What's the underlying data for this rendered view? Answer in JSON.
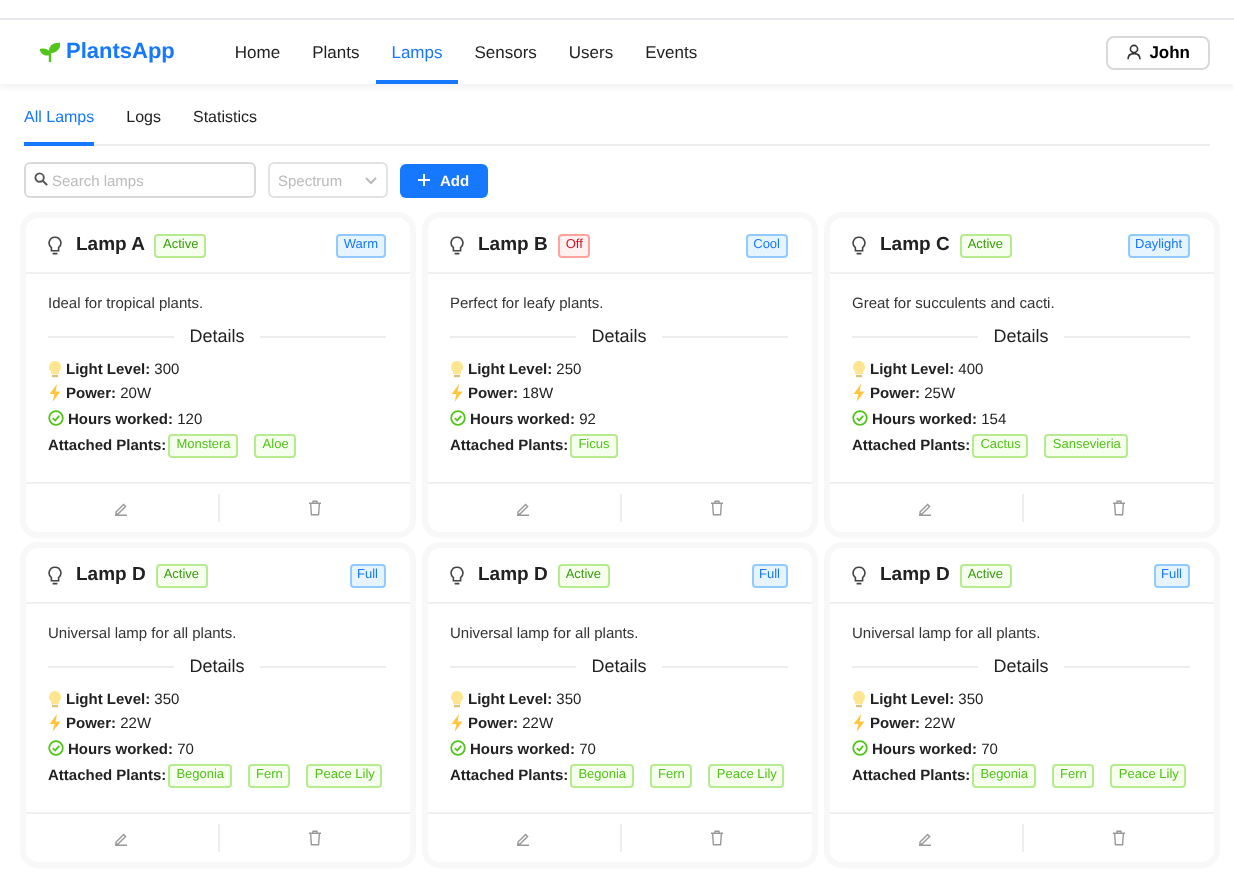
{
  "header": {
    "logo": "PlantsApp",
    "nav": [
      {
        "label": "Home",
        "selected": false
      },
      {
        "label": "Plants",
        "selected": false
      },
      {
        "label": "Lamps",
        "selected": true
      },
      {
        "label": "Sensors",
        "selected": false
      },
      {
        "label": "Users",
        "selected": false
      },
      {
        "label": "Events",
        "selected": false
      }
    ],
    "user": "John"
  },
  "tabs": [
    {
      "label": "All Lamps",
      "selected": true
    },
    {
      "label": "Logs",
      "selected": false
    },
    {
      "label": "Statistics",
      "selected": false
    }
  ],
  "toolbar": {
    "search": {
      "placeholder": "Search lamps"
    },
    "spectrum_select": {
      "placeholder": "Spectrum"
    },
    "add_button": "Add"
  },
  "lamps": [
    {
      "name": "Lamp A",
      "status": {
        "label": "Active",
        "kind": "active"
      },
      "spectrum": "Warm",
      "description": "Ideal for tropical plants.",
      "details_title": "Details",
      "stats": [
        {
          "kind": "light",
          "label": "Light Level:",
          "value": "300"
        },
        {
          "kind": "power",
          "label": "Power:",
          "value": "20W"
        },
        {
          "kind": "hours",
          "label": "Hours worked:",
          "value": "120"
        }
      ],
      "plants_label": "Attached Plants:",
      "plants": [
        "Monstera",
        "Aloe"
      ]
    },
    {
      "name": "Lamp B",
      "status": {
        "label": "Off",
        "kind": "off"
      },
      "spectrum": "Cool",
      "description": "Perfect for leafy plants.",
      "details_title": "Details",
      "stats": [
        {
          "kind": "light",
          "label": "Light Level:",
          "value": "250"
        },
        {
          "kind": "power",
          "label": "Power:",
          "value": "18W"
        },
        {
          "kind": "hours",
          "label": "Hours worked:",
          "value": "92"
        }
      ],
      "plants_label": "Attached Plants:",
      "plants": [
        "Ficus"
      ]
    },
    {
      "name": "Lamp C",
      "status": {
        "label": "Active",
        "kind": "active"
      },
      "spectrum": "Daylight",
      "description": "Great for succulents and cacti.",
      "details_title": "Details",
      "stats": [
        {
          "kind": "light",
          "label": "Light Level:",
          "value": "400"
        },
        {
          "kind": "power",
          "label": "Power:",
          "value": "25W"
        },
        {
          "kind": "hours",
          "label": "Hours worked:",
          "value": "154"
        }
      ],
      "plants_label": "Attached Plants:",
      "plants": [
        "Cactus",
        "Sansevieria"
      ]
    },
    {
      "name": "Lamp D",
      "status": {
        "label": "Active",
        "kind": "active"
      },
      "spectrum": "Full",
      "description": "Universal lamp for all plants.",
      "details_title": "Details",
      "stats": [
        {
          "kind": "light",
          "label": "Light Level:",
          "value": "350"
        },
        {
          "kind": "power",
          "label": "Power:",
          "value": "22W"
        },
        {
          "kind": "hours",
          "label": "Hours worked:",
          "value": "70"
        }
      ],
      "plants_label": "Attached Plants:",
      "plants": [
        "Begonia",
        "Fern",
        "Peace Lily"
      ]
    },
    {
      "name": "Lamp D",
      "status": {
        "label": "Active",
        "kind": "active"
      },
      "spectrum": "Full",
      "description": "Universal lamp for all plants.",
      "details_title": "Details",
      "stats": [
        {
          "kind": "light",
          "label": "Light Level:",
          "value": "350"
        },
        {
          "kind": "power",
          "label": "Power:",
          "value": "22W"
        },
        {
          "kind": "hours",
          "label": "Hours worked:",
          "value": "70"
        }
      ],
      "plants_label": "Attached Plants:",
      "plants": [
        "Begonia",
        "Fern",
        "Peace Lily"
      ]
    },
    {
      "name": "Lamp D",
      "status": {
        "label": "Active",
        "kind": "active"
      },
      "spectrum": "Full",
      "description": "Universal lamp for all plants.",
      "details_title": "Details",
      "stats": [
        {
          "kind": "light",
          "label": "Light Level:",
          "value": "350"
        },
        {
          "kind": "power",
          "label": "Power:",
          "value": "22W"
        },
        {
          "kind": "hours",
          "label": "Hours worked:",
          "value": "70"
        }
      ],
      "plants_label": "Attached Plants:",
      "plants": [
        "Begonia",
        "Fern",
        "Peace Lily"
      ]
    }
  ]
}
